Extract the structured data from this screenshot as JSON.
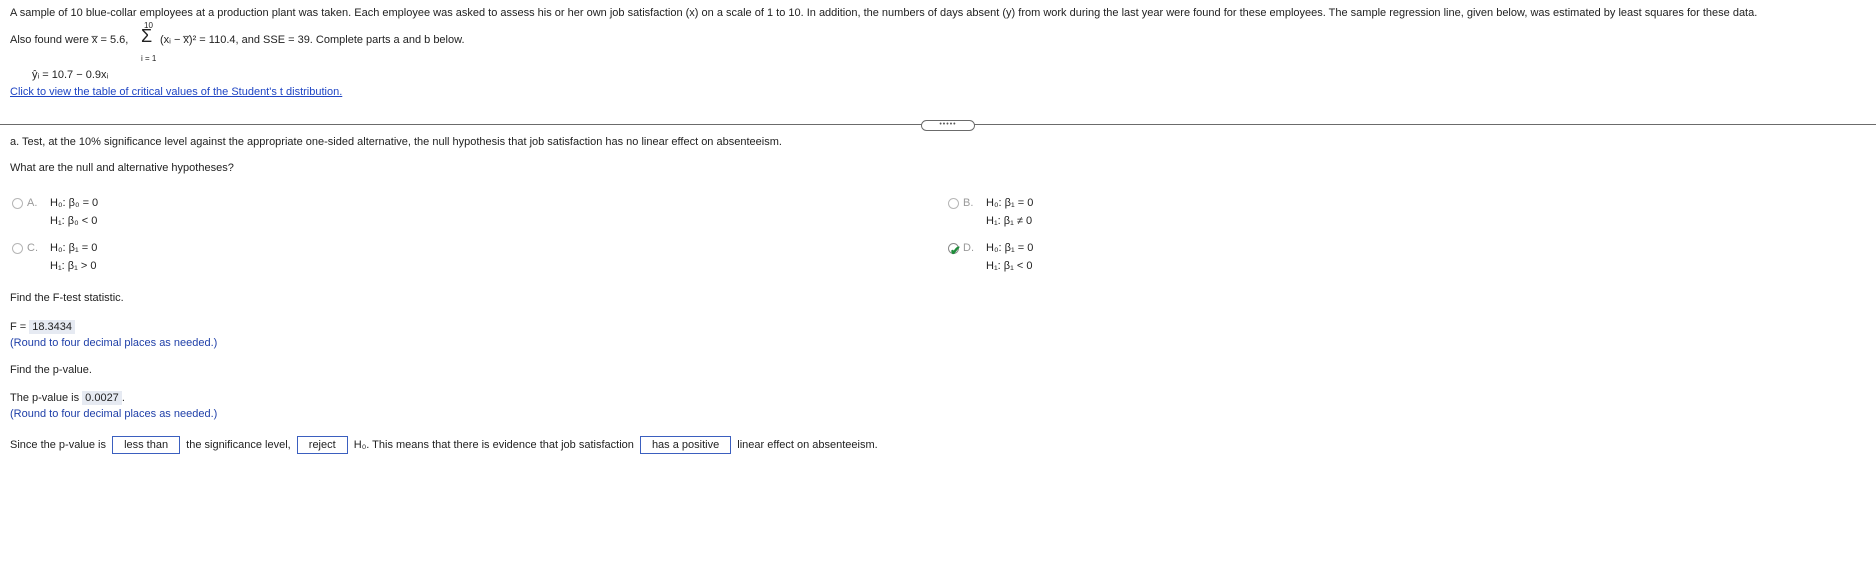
{
  "intro": "A sample of 10 blue-collar employees at a production plant was taken. Each employee was asked to assess his or her own job satisfaction (x) on a scale of 1 to 10. In addition, the numbers of days absent (y) from work during the last year were found for these employees. The sample regression line, given below, was estimated by least squares for these data.",
  "line2_pre": "Also found were x̅ = 5.6,",
  "sum_top": "10",
  "sum_bot": "i = 1",
  "sigma": "Σ",
  "line2_post": "(xᵢ − x̅)² = 110.4, and SSE = 39. Complete parts a and b below.",
  "regression": "ŷᵢ = 10.7 − 0.9xᵢ",
  "link": "Click to view the table of critical values of the Student's t distribution.",
  "handle": "•••••",
  "question_a": "a. Test, at the 10% significance level against the appropriate one-sided alternative, the null hypothesis that job satisfaction has no linear effect on absenteeism.",
  "question_hyp": "What are the null and alternative hypotheses?",
  "options": {
    "A": {
      "letter": "A.",
      "h0": "H₀: β₀ = 0",
      "h1": "H₁: β₀ < 0"
    },
    "B": {
      "letter": "B.",
      "h0": "H₀: β₁ = 0",
      "h1": "H₁: β₁ ≠ 0"
    },
    "C": {
      "letter": "C.",
      "h0": "H₀: β₁ = 0",
      "h1": "H₁: β₁ > 0"
    },
    "D": {
      "letter": "D.",
      "h0": "H₀: β₁ = 0",
      "h1": "H₁: β₁ < 0"
    }
  },
  "selected_option": "D",
  "find_f": "Find the F-test statistic.",
  "f_label": "F =",
  "f_value": "18.3434",
  "round_note": "(Round to four decimal places as needed.)",
  "find_p": "Find the p-value.",
  "p_label": "The p-value is",
  "p_value": "0.0027",
  "p_period": ".",
  "final": {
    "pre": "Since the p-value is",
    "sel1": "less than",
    "mid1": "the significance level,",
    "sel2": "reject",
    "mid2": "H₀. This means that there is evidence that job satisfaction",
    "sel3": "has a positive",
    "post": "linear effect on absenteeism."
  },
  "colors": {
    "link": "#1f45c4",
    "note": "#1f3fa8",
    "check": "#1e8c3a"
  }
}
